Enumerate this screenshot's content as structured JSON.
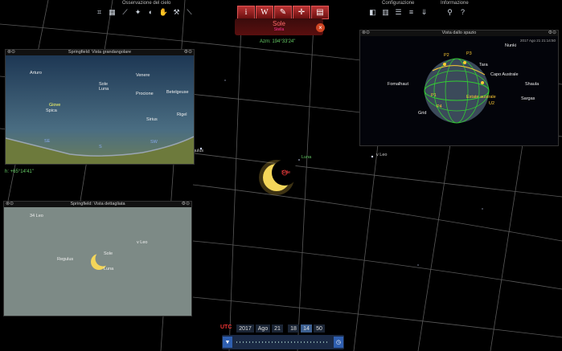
{
  "toolbar": {
    "sky_group_label": "Osservazione del cielo",
    "config_group_label": "Configurazione",
    "info_group_label": "Informazione",
    "info_button": "i",
    "wiki_button": "W"
  },
  "selected": {
    "name": "Sole",
    "type": "Stella",
    "azimuth": "Azm: 194°33'24\"",
    "altitude": "h: +65°14'41\""
  },
  "sky_labels": {
    "luna": "Luna",
    "sole": "Sole",
    "regulus": "gulus",
    "vleo": "v Leo"
  },
  "panel_wide": {
    "title": "Springfield: Vista grandangolare",
    "labels": [
      "Arturo",
      "Sole",
      "Luna",
      "Venere",
      "Procione",
      "Betelgeuse",
      "Giove",
      "Spica",
      "Sirius",
      "Rigel",
      "SE",
      "S",
      "SW"
    ]
  },
  "panel_detail": {
    "title": "Springfield: Vista dettagliata",
    "labels": [
      "34 Leo",
      "v Leo",
      "Regulus",
      "Sole",
      "Luna"
    ]
  },
  "panel_space": {
    "title": "Vista dallo spazio",
    "timestamp": "2017 Ago 21 21:14:50",
    "labels": [
      "Nunki",
      "P2",
      "P3",
      "Tara",
      "Fomalhaut",
      "Capo Australe",
      "Shaula",
      "Sargas",
      "P1",
      "P4",
      "Estate australe",
      "U2",
      "Grid"
    ]
  },
  "datetime": {
    "utc_label": "UTC",
    "year": "2017",
    "month": "Ago",
    "day": "21",
    "hour": "18",
    "minute": "14",
    "second": "50"
  },
  "colors": {
    "accent_red": "#c02a2a",
    "label_green": "#66cc66",
    "sun_yellow": "#f2d24a"
  }
}
